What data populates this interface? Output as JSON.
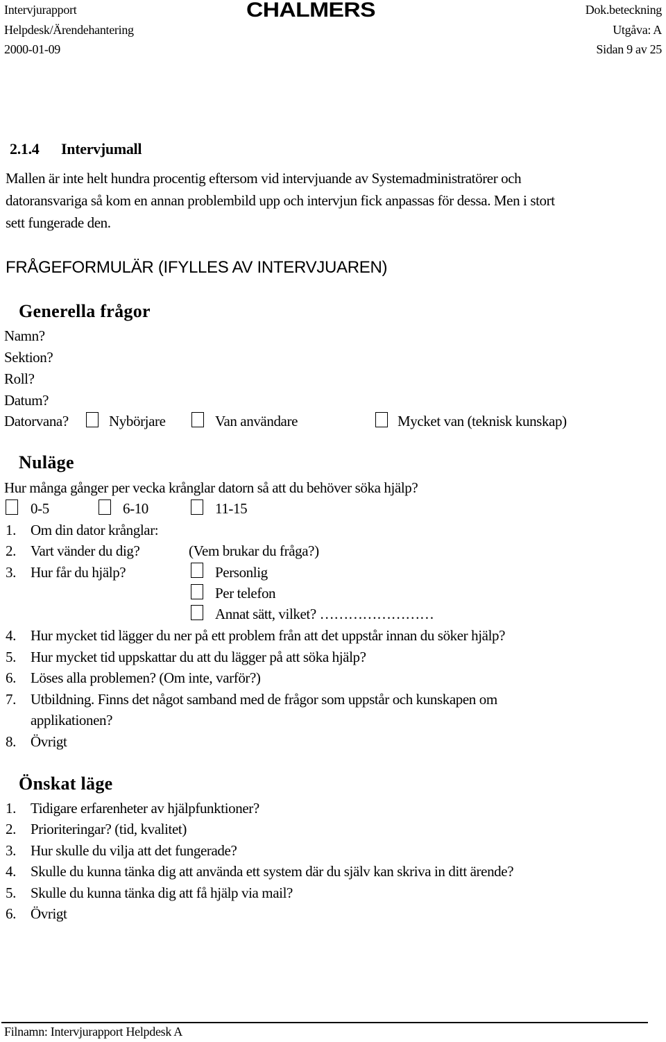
{
  "header": {
    "left": [
      "Intervjurapport",
      "Helpdesk/Ärendehantering",
      "2000-01-09"
    ],
    "logo": "CHALMERS",
    "right": [
      "Dok.beteckning",
      "Utgåva: A",
      "Sidan 9 av 25"
    ]
  },
  "section": {
    "number": "2.1.4",
    "title": "Intervjumall",
    "paragraph": [
      "Mallen är inte helt hundra procentig eftersom vid intervjuande av Systemadministratörer och",
      "datoransvariga så kom en annan problembild upp och intervjun fick anpassas för dessa. Men i stort",
      "sett fungerade den."
    ]
  },
  "form": {
    "title": "FRÅGEFORMULÄR (IFYLLES AV INTERVJUAREN)",
    "general": {
      "heading": "Generella frågor",
      "fields": [
        "Namn?",
        "Sektion?",
        "Roll?",
        "Datum?"
      ],
      "experience_label": "Datorvana?",
      "experience_options": [
        "Nybörjare",
        "Van användare",
        "Mycket van (teknisk kunskap)"
      ]
    },
    "current": {
      "heading": "Nuläge",
      "frequency_question": "Hur många gånger per vecka krånglar datorn så att du behöver söka hjälp?",
      "frequency_options": [
        "0-5",
        "6-10",
        "11-15"
      ],
      "questions": [
        {
          "num": "1.",
          "text": "Om din dator krånglar:"
        },
        {
          "num": "2.",
          "text": "Vart vänder du dig?",
          "extra": "(Vem brukar du fråga?)"
        },
        {
          "num": "3.",
          "text": "Hur får du hjälp?",
          "options": [
            "Personlig",
            "Per telefon",
            "Annat sätt, vilket?  ……………………"
          ]
        },
        {
          "num": "4.",
          "text": "Hur mycket tid lägger du ner på ett problem från att det uppstår innan du söker hjälp?"
        },
        {
          "num": "5.",
          "text": "Hur mycket tid uppskattar du att du lägger på att söka hjälp?"
        },
        {
          "num": "6.",
          "text": "Löses alla problemen? (Om inte, varför?)"
        },
        {
          "num": "7.",
          "text": "Utbildning. Finns det något samband med de frågor som uppstår och kunskapen om",
          "text2": "applikationen?"
        },
        {
          "num": "8.",
          "text": "Övrigt"
        }
      ]
    },
    "desired": {
      "heading": "Önskat läge",
      "questions": [
        {
          "num": "1.",
          "text": "Tidigare erfarenheter av hjälpfunktioner?"
        },
        {
          "num": "2.",
          "text": "Prioriteringar? (tid, kvalitet)"
        },
        {
          "num": "3.",
          "text": "Hur skulle du vilja att det fungerade?"
        },
        {
          "num": "4.",
          "text": "Skulle du kunna tänka dig att använda ett system där du själv kan skriva in ditt ärende?"
        },
        {
          "num": "5.",
          "text": "Skulle du kunna tänka dig att få hjälp via mail?"
        },
        {
          "num": "6.",
          "text": "Övrigt"
        }
      ]
    }
  },
  "footer": {
    "filename": "Filnamn: Intervjurapport Helpdesk A"
  }
}
